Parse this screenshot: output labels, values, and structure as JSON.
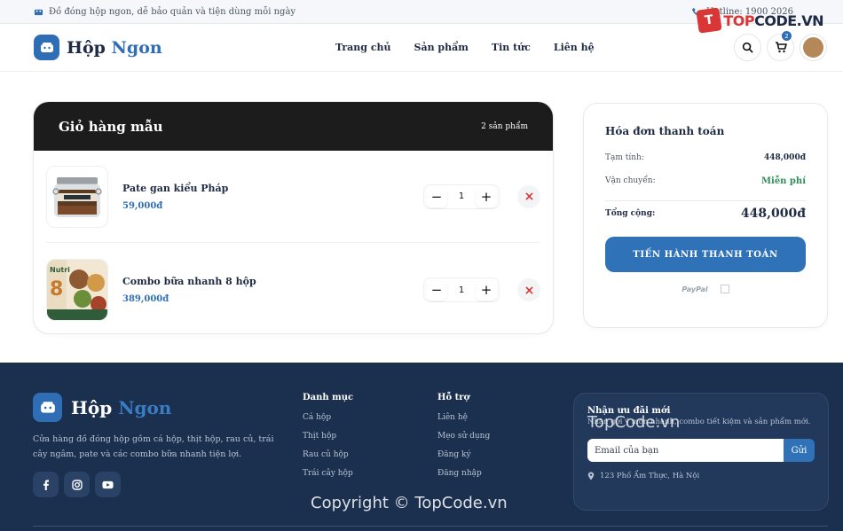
{
  "topbar": {
    "tagline": "Đồ đóng hộp ngon, dễ bảo quản và tiện dùng mỗi ngày",
    "hotline": "Hotline: 1900 2026"
  },
  "watermark_logo": {
    "mark": "T",
    "text_a": "TOP",
    "text_b": "CODE.VN"
  },
  "header": {
    "brand_a": "Hộp",
    "brand_b": "Ngon",
    "nav": [
      "Trang chủ",
      "Sản phẩm",
      "Tin tức",
      "Liên hệ"
    ],
    "cart_count": "2"
  },
  "cart": {
    "title": "Giỏ hàng mẫu",
    "count_label": "2 sản phẩm",
    "items": [
      {
        "name": "Pate gan kiểu Pháp",
        "price": "59,000đ",
        "qty": "1"
      },
      {
        "name": "Combo bữa nhanh 8 hộp",
        "price": "389,000đ",
        "qty": "1"
      }
    ]
  },
  "invoice": {
    "title": "Hóa đơn thanh toán",
    "subtotal_label": "Tạm tính:",
    "subtotal_value": "448,000đ",
    "shipping_label": "Vận chuyển:",
    "shipping_value": "Miễn phí",
    "total_label": "Tổng cộng:",
    "total_value": "448,000đ",
    "checkout_label": "TIẾN HÀNH THANH TOÁN",
    "paypal": "PayPal"
  },
  "footer": {
    "brand_a": "Hộp",
    "brand_b": "Ngon",
    "desc": "Cửa hàng đồ đóng hộp gồm cá hộp, thịt hộp, rau củ, trái cây ngâm, pate và các combo bữa nhanh tiện lợi.",
    "col1": {
      "title": "Danh mục",
      "items": [
        "Cá hộp",
        "Thịt hộp",
        "Rau củ hộp",
        "Trái cây hộp"
      ]
    },
    "col2": {
      "title": "Hỗ trợ",
      "items": [
        "Liên hệ",
        "Mẹo sử dụng",
        "Đăng ký",
        "Đăng nhập"
      ]
    },
    "newsletter": {
      "title": "Nhận ưu đãi mới",
      "subtitle": "Nhận gợi ý món nhanh, combo tiết kiệm và sản phẩm mới.",
      "placeholder": "Email của bạn",
      "send": "Gửi",
      "address": "123 Phố Ẩm Thực, Hà Nội"
    }
  },
  "watermarks": {
    "site": "TopCode.vn",
    "copyright": "Copyright © TopCode.vn"
  },
  "colors": {
    "primary": "#2f6eb5",
    "dark": "#1c1c1c",
    "footer_bg": "#1b2f4e",
    "danger": "#d93636",
    "success": "#2f8f5a"
  }
}
